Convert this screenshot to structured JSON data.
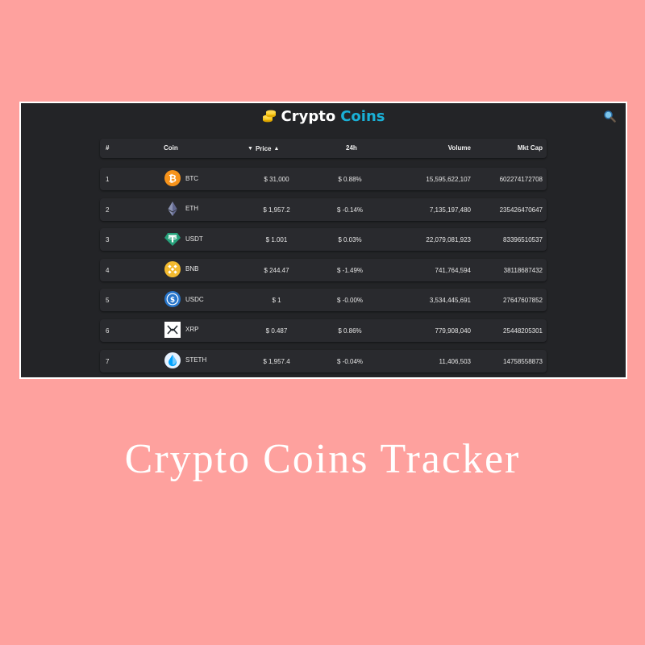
{
  "header": {
    "brand_part1": "Crypto",
    "brand_part2": "Coins",
    "brand_icon": "coin-stack-icon",
    "search_icon": "search-icon"
  },
  "colors": {
    "page_bg": "#fea19e",
    "panel_bg": "#232427",
    "row_bg": "#292a2e",
    "accent": "#1ab0d6"
  },
  "table": {
    "columns": {
      "rank": "#",
      "coin": "Coin",
      "price": "Price",
      "change": "24h",
      "volume": "Volume",
      "mktcap": "Mkt Cap"
    },
    "sort_down_arrow": "▼",
    "sort_up_arrow": "▲",
    "rows": [
      {
        "rank": "1",
        "symbol": "BTC",
        "price": "$ 31,000",
        "change": "$ 0.88%",
        "volume": "15,595,622,107",
        "mktcap": "602274172708",
        "icon": "bitcoin-icon"
      },
      {
        "rank": "2",
        "symbol": "ETH",
        "price": "$ 1,957.2",
        "change": "$ -0.14%",
        "volume": "7,135,197,480",
        "mktcap": "235426470647",
        "icon": "ethereum-icon"
      },
      {
        "rank": "3",
        "symbol": "USDT",
        "price": "$ 1.001",
        "change": "$ 0.03%",
        "volume": "22,079,081,923",
        "mktcap": "83396510537",
        "icon": "tether-icon"
      },
      {
        "rank": "4",
        "symbol": "BNB",
        "price": "$ 244.47",
        "change": "$ -1.49%",
        "volume": "741,764,594",
        "mktcap": "38118687432",
        "icon": "bnb-icon"
      },
      {
        "rank": "5",
        "symbol": "USDC",
        "price": "$ 1",
        "change": "$ -0.00%",
        "volume": "3,534,445,691",
        "mktcap": "27647607852",
        "icon": "usdc-icon"
      },
      {
        "rank": "6",
        "symbol": "XRP",
        "price": "$ 0.487",
        "change": "$ 0.86%",
        "volume": "779,908,040",
        "mktcap": "25448205301",
        "icon": "xrp-icon"
      },
      {
        "rank": "7",
        "symbol": "STETH",
        "price": "$ 1,957.4",
        "change": "$ -0.04%",
        "volume": "11,406,503",
        "mktcap": "14758558873",
        "icon": "steth-icon"
      }
    ]
  },
  "caption": "Crypto Coins Tracker"
}
